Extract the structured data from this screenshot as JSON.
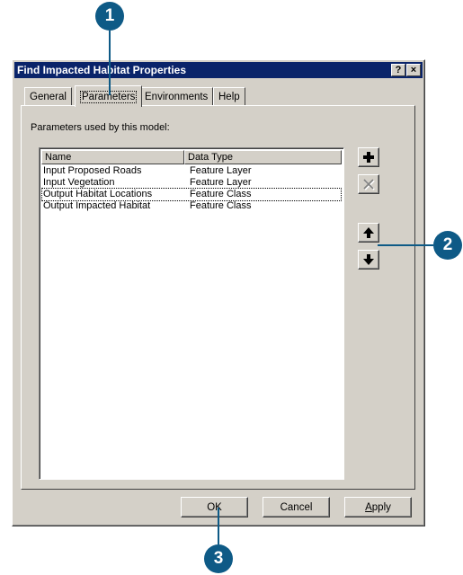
{
  "callouts": [
    "1",
    "2",
    "3"
  ],
  "dialog": {
    "title": "Find Impacted Habitat Properties",
    "help_glyph": "?",
    "close_glyph": "×"
  },
  "tabs": [
    {
      "label": "General"
    },
    {
      "label": "Parameters",
      "active": true
    },
    {
      "label": "Environments"
    },
    {
      "label": "Help"
    }
  ],
  "panel": {
    "label": "Parameters used by this model:",
    "columns": [
      "Name",
      "Data Type"
    ],
    "rows": [
      {
        "name": "Input Proposed Roads",
        "type": "Feature Layer"
      },
      {
        "name": "Input Vegetation",
        "type": "Feature Layer"
      },
      {
        "name": "Output Habitat Locations",
        "type": "Feature Class"
      },
      {
        "name": "Output Impacted Habitat",
        "type": "Feature Class"
      }
    ],
    "side_buttons": [
      {
        "icon": "add-icon",
        "enabled": true
      },
      {
        "icon": "delete-icon",
        "enabled": false
      },
      {
        "icon": "arrow-up-icon",
        "enabled": true
      },
      {
        "icon": "arrow-down-icon",
        "enabled": true
      }
    ]
  },
  "buttons": {
    "ok": "OK",
    "cancel": "Cancel",
    "apply_mnemonic": "A",
    "apply_rest": "pply"
  }
}
